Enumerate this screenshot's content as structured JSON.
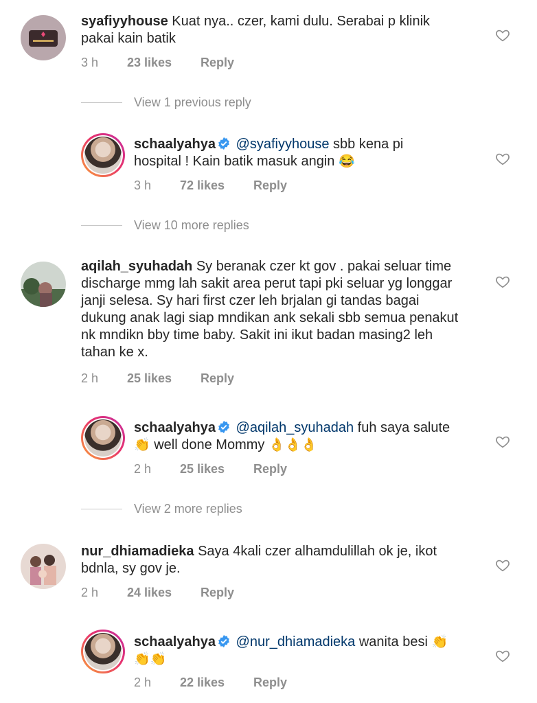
{
  "comments": [
    {
      "username": "syafiyyhouse",
      "body": "Kuat nya.. czer, kami dulu. Serabai p klinik pakai kain batik",
      "time": "3 h",
      "likes": "23 likes",
      "reply": "Reply"
    },
    {
      "username": "aqilah_syuhadah",
      "body": "Sy beranak czer kt gov . pakai seluar time discharge mmg lah sakit area perut tapi pki seluar yg longgar janji selesa. Sy hari first czer leh brjalan gi tandas bagai dukung anak lagi siap mndikan ank sekali sbb semua penakut nk mndikn bby time baby. Sakit ini ikut badan masing2 leh tahan ke x.",
      "time": "2 h",
      "likes": "25 likes",
      "reply": "Reply"
    },
    {
      "username": "nur_dhiamadieka",
      "body": "Saya 4kali czer alhamdulillah ok je, ikot bdnla, sy gov je.",
      "time": "2 h",
      "likes": "24 likes",
      "reply": "Reply"
    }
  ],
  "replies": [
    {
      "username": "schaalyahya",
      "mention": "@syafiyyhouse",
      "body_line1": " sbb kena pi",
      "body_line2": "hospital ! Kain batik masuk angin ",
      "emoji": "😂",
      "time": "3 h",
      "likes": "72 likes",
      "reply": "Reply"
    },
    {
      "username": "schaalyahya",
      "mention": "@aqilah_syuhadah",
      "body_line1": " fuh saya salute",
      "emoji_line2": "👏",
      "body_line2": " well done Mommy ",
      "emoji_tail": "👌👌👌",
      "time": "2 h",
      "likes": "25 likes",
      "reply": "Reply"
    },
    {
      "username": "schaalyahya",
      "mention": "@nur_dhiamadieka",
      "body_line1": " wanita besi ",
      "emoji_line1": "👏",
      "emoji_line2": "👏👏",
      "time": "2 h",
      "likes": "22 likes",
      "reply": "Reply"
    }
  ],
  "view_replies": [
    "View 1 previous reply",
    "View 10 more replies",
    "View 2 more replies"
  ],
  "colors": {
    "mention": "#00376b",
    "meta": "#8e8e8e",
    "verified": "#3897f0"
  },
  "icons": {
    "like": "heart-outline-icon",
    "verified": "verified-badge-icon"
  }
}
